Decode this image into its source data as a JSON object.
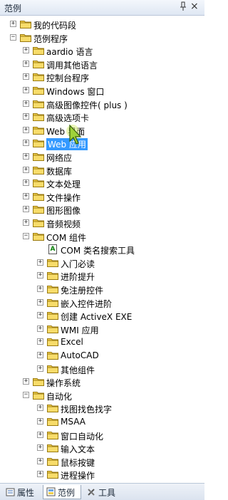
{
  "panel": {
    "title": "范例",
    "pin_glyph": "ᵖ",
    "close_glyph": "×"
  },
  "tree": [
    {
      "label": "我的代码段",
      "level": 1,
      "expander": "+",
      "icon": "folder-icon"
    },
    {
      "label": "范例程序",
      "level": 1,
      "expander": "−",
      "icon": "folder-icon"
    },
    {
      "label": "aardio 语言",
      "level": 2,
      "expander": "+",
      "icon": "folder-icon"
    },
    {
      "label": "调用其他语言",
      "level": 2,
      "expander": "+",
      "icon": "folder-icon"
    },
    {
      "label": "控制台程序",
      "level": 2,
      "expander": "+",
      "icon": "folder-icon"
    },
    {
      "label": "Windows 窗口",
      "level": 2,
      "expander": "+",
      "icon": "folder-icon"
    },
    {
      "label": "高级图像控件( plus )",
      "level": 2,
      "expander": "+",
      "icon": "folder-icon"
    },
    {
      "label": "高级选项卡",
      "level": 2,
      "expander": "+",
      "icon": "folder-icon"
    },
    {
      "label": "Web 界面",
      "level": 2,
      "expander": "+",
      "icon": "folder-icon"
    },
    {
      "label": "Web 应用",
      "level": 2,
      "expander": "+",
      "icon": "folder-icon",
      "selected": true
    },
    {
      "label": "网络应",
      "level": 2,
      "expander": "+",
      "icon": "folder-icon"
    },
    {
      "label": "数据库",
      "level": 2,
      "expander": "+",
      "icon": "folder-icon"
    },
    {
      "label": "文本处理",
      "level": 2,
      "expander": "+",
      "icon": "folder-icon"
    },
    {
      "label": "文件操作",
      "level": 2,
      "expander": "+",
      "icon": "folder-icon"
    },
    {
      "label": "图形图像",
      "level": 2,
      "expander": "+",
      "icon": "folder-icon"
    },
    {
      "label": "音频视频",
      "level": 2,
      "expander": "+",
      "icon": "folder-icon"
    },
    {
      "label": "COM 组件",
      "level": 2,
      "expander": "−",
      "icon": "folder-icon"
    },
    {
      "label": "COM 类名搜索工具",
      "level": 3,
      "expander": "",
      "icon": "file-icon"
    },
    {
      "label": "入门必读",
      "level": 3,
      "expander": "+",
      "icon": "folder-icon"
    },
    {
      "label": "进阶提升",
      "level": 3,
      "expander": "+",
      "icon": "folder-icon"
    },
    {
      "label": "免注册控件",
      "level": 3,
      "expander": "+",
      "icon": "folder-icon"
    },
    {
      "label": "嵌入控件进阶",
      "level": 3,
      "expander": "+",
      "icon": "folder-icon"
    },
    {
      "label": "创建 ActiveX EXE",
      "level": 3,
      "expander": "+",
      "icon": "folder-icon"
    },
    {
      "label": "WMI 应用",
      "level": 3,
      "expander": "+",
      "icon": "folder-icon"
    },
    {
      "label": "Excel",
      "level": 3,
      "expander": "+",
      "icon": "folder-icon"
    },
    {
      "label": "AutoCAD",
      "level": 3,
      "expander": "+",
      "icon": "folder-icon"
    },
    {
      "label": "其他组件",
      "level": 3,
      "expander": "+",
      "icon": "folder-icon"
    },
    {
      "label": "操作系统",
      "level": 2,
      "expander": "+",
      "icon": "folder-icon"
    },
    {
      "label": "自动化",
      "level": 2,
      "expander": "−",
      "icon": "folder-icon"
    },
    {
      "label": "找图找色找字",
      "level": 3,
      "expander": "+",
      "icon": "folder-icon"
    },
    {
      "label": "MSAA",
      "level": 3,
      "expander": "+",
      "icon": "folder-icon"
    },
    {
      "label": "窗口自动化",
      "level": 3,
      "expander": "+",
      "icon": "folder-icon"
    },
    {
      "label": "输入文本",
      "level": 3,
      "expander": "+",
      "icon": "folder-icon"
    },
    {
      "label": "鼠标按键",
      "level": 3,
      "expander": "+",
      "icon": "folder-icon"
    },
    {
      "label": "进程操作",
      "level": 3,
      "expander": "+",
      "icon": "folder-icon"
    }
  ],
  "tabs": [
    {
      "label": "属性",
      "icon": "properties-icon",
      "active": false
    },
    {
      "label": "范例",
      "icon": "examples-icon",
      "active": true
    },
    {
      "label": "工具",
      "icon": "tools-icon",
      "active": false
    }
  ],
  "colors": {
    "selection": "#3399ff",
    "folder": "#f2cf4a"
  }
}
